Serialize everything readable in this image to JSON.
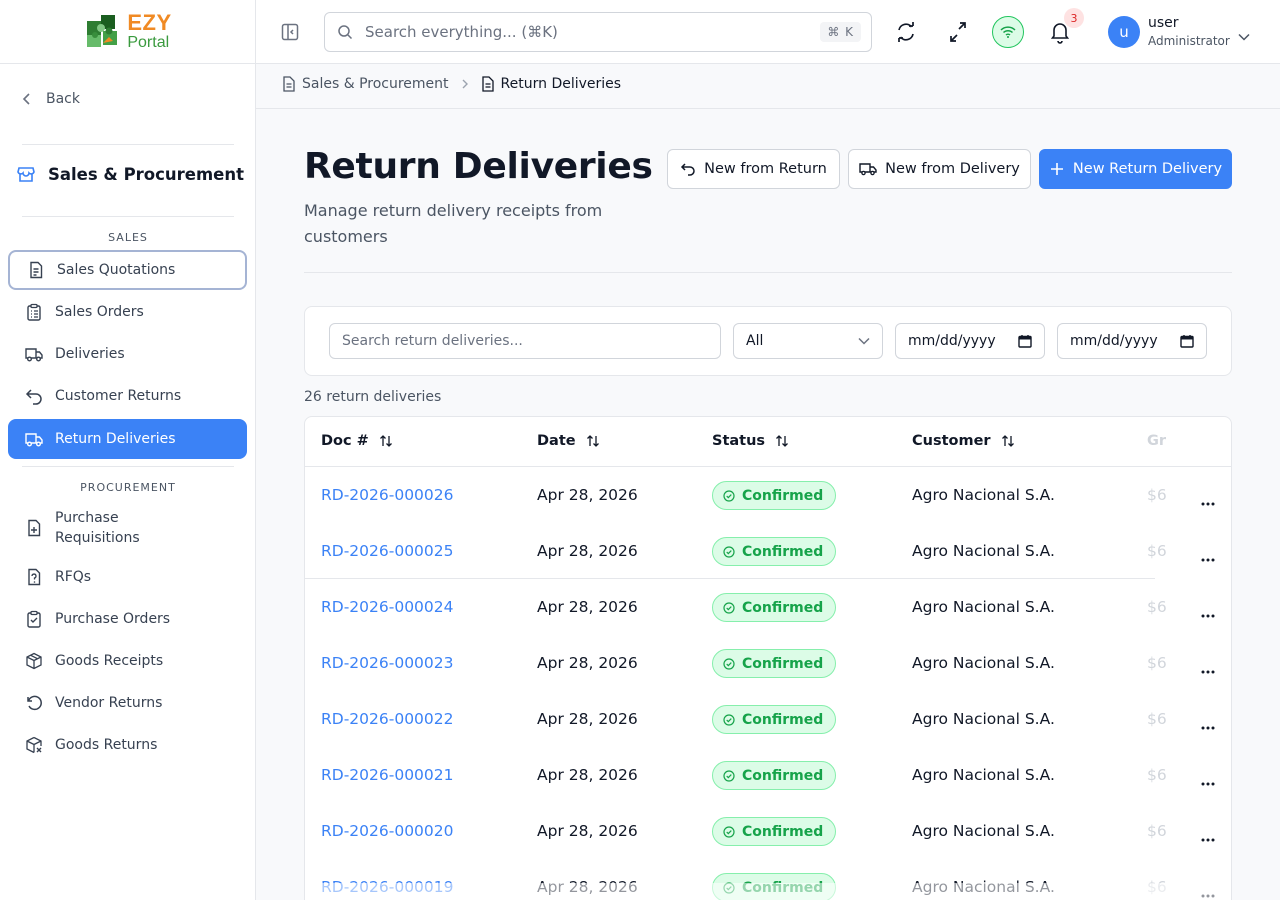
{
  "brand": {
    "line1": "EZY",
    "line2": "Portal"
  },
  "sidebar": {
    "back_label": "Back",
    "module_title": "Sales & Procurement",
    "sections": {
      "sales": "SALES",
      "procurement": "PROCUREMENT"
    },
    "sales_items": [
      {
        "label": "Sales Quotations",
        "icon": "file-text-icon"
      },
      {
        "label": "Sales Orders",
        "icon": "clipboard-list-icon"
      },
      {
        "label": "Deliveries",
        "icon": "truck-icon"
      },
      {
        "label": "Customer Returns",
        "icon": "undo-icon"
      },
      {
        "label": "Return Deliveries",
        "icon": "truck-return-icon",
        "active": true
      }
    ],
    "procurement_items": [
      {
        "label_line1": "Purchase",
        "label_line2": "Requisitions",
        "icon": "file-plus-icon"
      },
      {
        "label": "RFQs",
        "icon": "file-question-icon"
      },
      {
        "label": "Purchase Orders",
        "icon": "clipboard-check-icon"
      },
      {
        "label": "Goods Receipts",
        "icon": "package-icon"
      },
      {
        "label": "Vendor Returns",
        "icon": "rotate-ccw-icon"
      },
      {
        "label": "Goods Returns",
        "icon": "package-x-icon"
      }
    ]
  },
  "topbar": {
    "search_placeholder": "Search everything... (⌘K)",
    "shortcut": "⌘ K",
    "notification_count": "3",
    "user": {
      "initial": "u",
      "name": "user",
      "role": "Administrator"
    }
  },
  "breadcrumb": {
    "parent": "Sales & Procurement",
    "current": "Return Deliveries"
  },
  "header": {
    "title": "Return Deliveries",
    "subtitle": "Manage return delivery receipts from customers",
    "buttons": {
      "new_from_return": "New from Return",
      "new_from_delivery": "New from Delivery",
      "new_return_delivery": "New Return Delivery"
    },
    "accent_color": "#3b82f6"
  },
  "filters": {
    "search_placeholder": "Search return deliveries...",
    "status_value": "All",
    "date_from_placeholder": "mm/dd/yyyy",
    "date_to_placeholder": "mm/dd/yyyy"
  },
  "results_count": "26 return deliveries",
  "table": {
    "columns": {
      "doc": "Doc #",
      "date": "Date",
      "status": "Status",
      "customer": "Customer",
      "gross_partial": "Gr"
    },
    "rows": [
      {
        "doc": "RD-2026-000026",
        "date": "Apr 28, 2026",
        "status": "Confirmed",
        "customer": "Agro Nacional S.A.",
        "gross_partial": "$6"
      },
      {
        "doc": "RD-2026-000025",
        "date": "Apr 28, 2026",
        "status": "Confirmed",
        "customer": "Agro Nacional S.A.",
        "gross_partial": "$6"
      },
      {
        "doc": "RD-2026-000024",
        "date": "Apr 28, 2026",
        "status": "Confirmed",
        "customer": "Agro Nacional S.A.",
        "gross_partial": "$6"
      },
      {
        "doc": "RD-2026-000023",
        "date": "Apr 28, 2026",
        "status": "Confirmed",
        "customer": "Agro Nacional S.A.",
        "gross_partial": "$6"
      },
      {
        "doc": "RD-2026-000022",
        "date": "Apr 28, 2026",
        "status": "Confirmed",
        "customer": "Agro Nacional S.A.",
        "gross_partial": "$6"
      },
      {
        "doc": "RD-2026-000021",
        "date": "Apr 28, 2026",
        "status": "Confirmed",
        "customer": "Agro Nacional S.A.",
        "gross_partial": "$6"
      },
      {
        "doc": "RD-2026-000020",
        "date": "Apr 28, 2026",
        "status": "Confirmed",
        "customer": "Agro Nacional S.A.",
        "gross_partial": "$6"
      },
      {
        "doc": "RD-2026-000019",
        "date": "Apr 28, 2026",
        "status": "Confirmed",
        "customer": "Agro Nacional S.A.",
        "gross_partial": "$6"
      }
    ],
    "status_color": "#16a34a"
  }
}
